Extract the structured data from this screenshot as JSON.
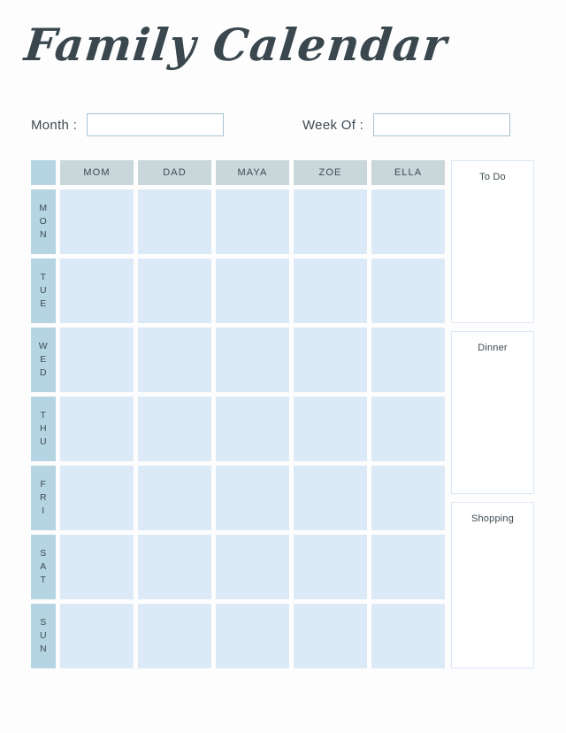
{
  "page": {
    "title": "Family Calendar",
    "background_color": "#fdfdfd",
    "accent_color": "#b5d5e3",
    "cell_color": "#dce9f7",
    "header_color": "#c9d6da",
    "text_color": "#3d4a52"
  },
  "fields": {
    "month": {
      "label": "Month :",
      "value": "",
      "placeholder": ""
    },
    "week_of": {
      "label": "Week Of :",
      "value": "",
      "placeholder": ""
    }
  },
  "calendar": {
    "corner_label": "",
    "people": [
      "MOM",
      "DAD",
      "MAYA",
      "ZOE",
      "ELLA"
    ],
    "days": [
      {
        "label": "MON",
        "letters": [
          "M",
          "O",
          "N"
        ],
        "entries": [
          "",
          "",
          "",
          "",
          ""
        ]
      },
      {
        "label": "TUE",
        "letters": [
          "T",
          "U",
          "E"
        ],
        "entries": [
          "",
          "",
          "",
          "",
          ""
        ]
      },
      {
        "label": "WED",
        "letters": [
          "W",
          "E",
          "D"
        ],
        "entries": [
          "",
          "",
          "",
          "",
          ""
        ]
      },
      {
        "label": "THU",
        "letters": [
          "T",
          "H",
          "U"
        ],
        "entries": [
          "",
          "",
          "",
          "",
          ""
        ]
      },
      {
        "label": "FRI",
        "letters": [
          "F",
          "R",
          "I"
        ],
        "entries": [
          "",
          "",
          "",
          "",
          ""
        ]
      },
      {
        "label": "SAT",
        "letters": [
          "S",
          "A",
          "T"
        ],
        "entries": [
          "",
          "",
          "",
          "",
          ""
        ]
      },
      {
        "label": "SUN",
        "letters": [
          "S",
          "U",
          "N"
        ],
        "entries": [
          "",
          "",
          "",
          "",
          ""
        ]
      }
    ]
  },
  "notes": {
    "todo": {
      "title": "To Do",
      "content": ""
    },
    "dinner": {
      "title": "Dinner",
      "content": ""
    },
    "shopping": {
      "title": "Shopping",
      "content": ""
    }
  }
}
